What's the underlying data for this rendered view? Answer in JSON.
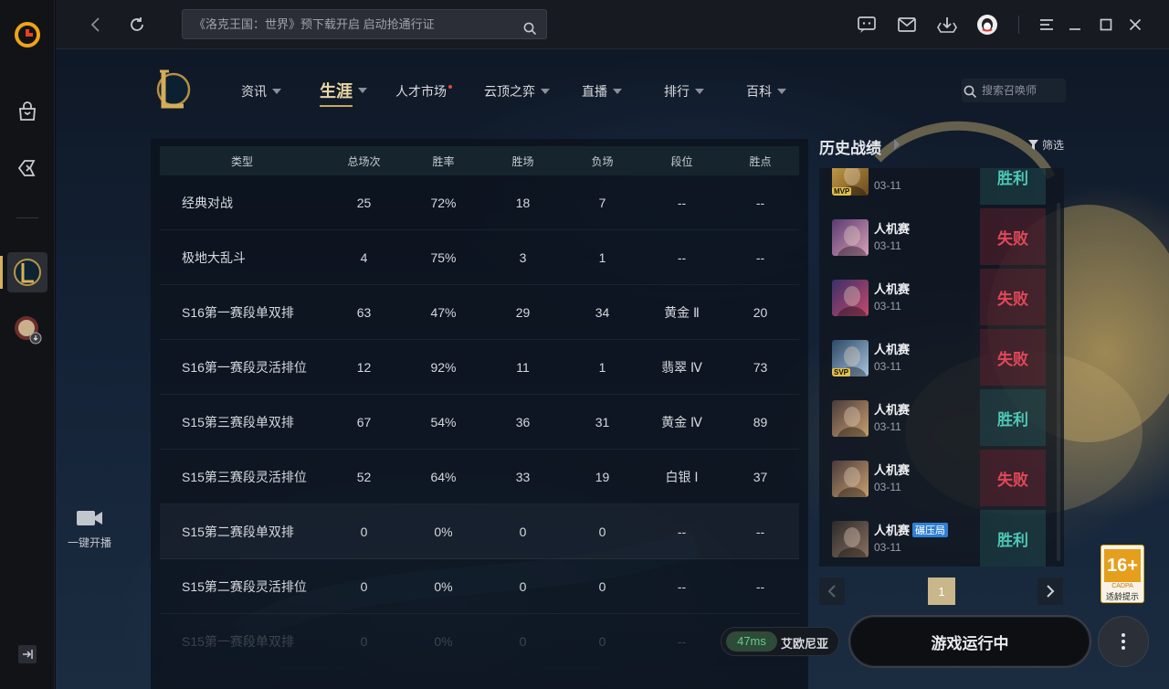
{
  "topbar": {
    "search_text": "《洛克王国：世界》预下载开启 启动抢通行证"
  },
  "nav": {
    "items": [
      {
        "label": "资讯"
      },
      {
        "label": "生涯"
      },
      {
        "label": "人才市场"
      },
      {
        "label": "云顶之弈"
      },
      {
        "label": "直播"
      },
      {
        "label": "排行"
      },
      {
        "label": "百科"
      }
    ],
    "search_placeholder": "搜索召唤师"
  },
  "sidebar": {
    "live_label": "一键开播"
  },
  "table": {
    "headers": [
      "类型",
      "总场次",
      "胜率",
      "胜场",
      "负场",
      "段位",
      "胜点"
    ],
    "rows": [
      [
        "经典对战",
        "25",
        "72%",
        "18",
        "7",
        "--",
        "--"
      ],
      [
        "极地大乱斗",
        "4",
        "75%",
        "3",
        "1",
        "--",
        "--"
      ],
      [
        "S16第一赛段单双排",
        "63",
        "47%",
        "29",
        "34",
        "黄金 Ⅱ",
        "20"
      ],
      [
        "S16第一赛段灵活排位",
        "12",
        "92%",
        "11",
        "1",
        "翡翠 Ⅳ",
        "73"
      ],
      [
        "S15第三赛段单双排",
        "67",
        "54%",
        "36",
        "31",
        "黄金 Ⅳ",
        "89"
      ],
      [
        "S15第三赛段灵活排位",
        "52",
        "64%",
        "33",
        "19",
        "白银 Ⅰ",
        "37"
      ],
      [
        "S15第二赛段单双排",
        "0",
        "0%",
        "0",
        "0",
        "--",
        "--"
      ],
      [
        "S15第二赛段灵活排位",
        "0",
        "0%",
        "0",
        "0",
        "--",
        "--"
      ],
      [
        "S15第一赛段单双排",
        "0",
        "0%",
        "0",
        "0",
        "--",
        "--"
      ]
    ]
  },
  "history": {
    "title": "历史战绩",
    "filter_label": "筛选",
    "matches": [
      {
        "mode": "",
        "date": "03-11",
        "result": "胜利",
        "badge": "MVP"
      },
      {
        "mode": "人机赛",
        "date": "03-11",
        "result": "失败"
      },
      {
        "mode": "人机赛",
        "date": "03-11",
        "result": "失败"
      },
      {
        "mode": "人机赛",
        "date": "03-11",
        "result": "失败",
        "badge": "SVP"
      },
      {
        "mode": "人机赛",
        "date": "03-11",
        "result": "胜利"
      },
      {
        "mode": "人机赛",
        "date": "03-11",
        "result": "失败"
      },
      {
        "mode": "人机赛",
        "date": "03-11",
        "result": "胜利",
        "tag": "碾压局"
      }
    ],
    "page": "1"
  },
  "age_rating": {
    "value": "16+",
    "org": "CADPA",
    "tip": "适龄提示"
  },
  "status": {
    "ping": "47ms",
    "server": "艾欧尼亚"
  },
  "game_button": "游戏运行中",
  "colors": {
    "win": "#4fc6b5",
    "lose": "#e0485a",
    "accent": "#c9a85a"
  }
}
